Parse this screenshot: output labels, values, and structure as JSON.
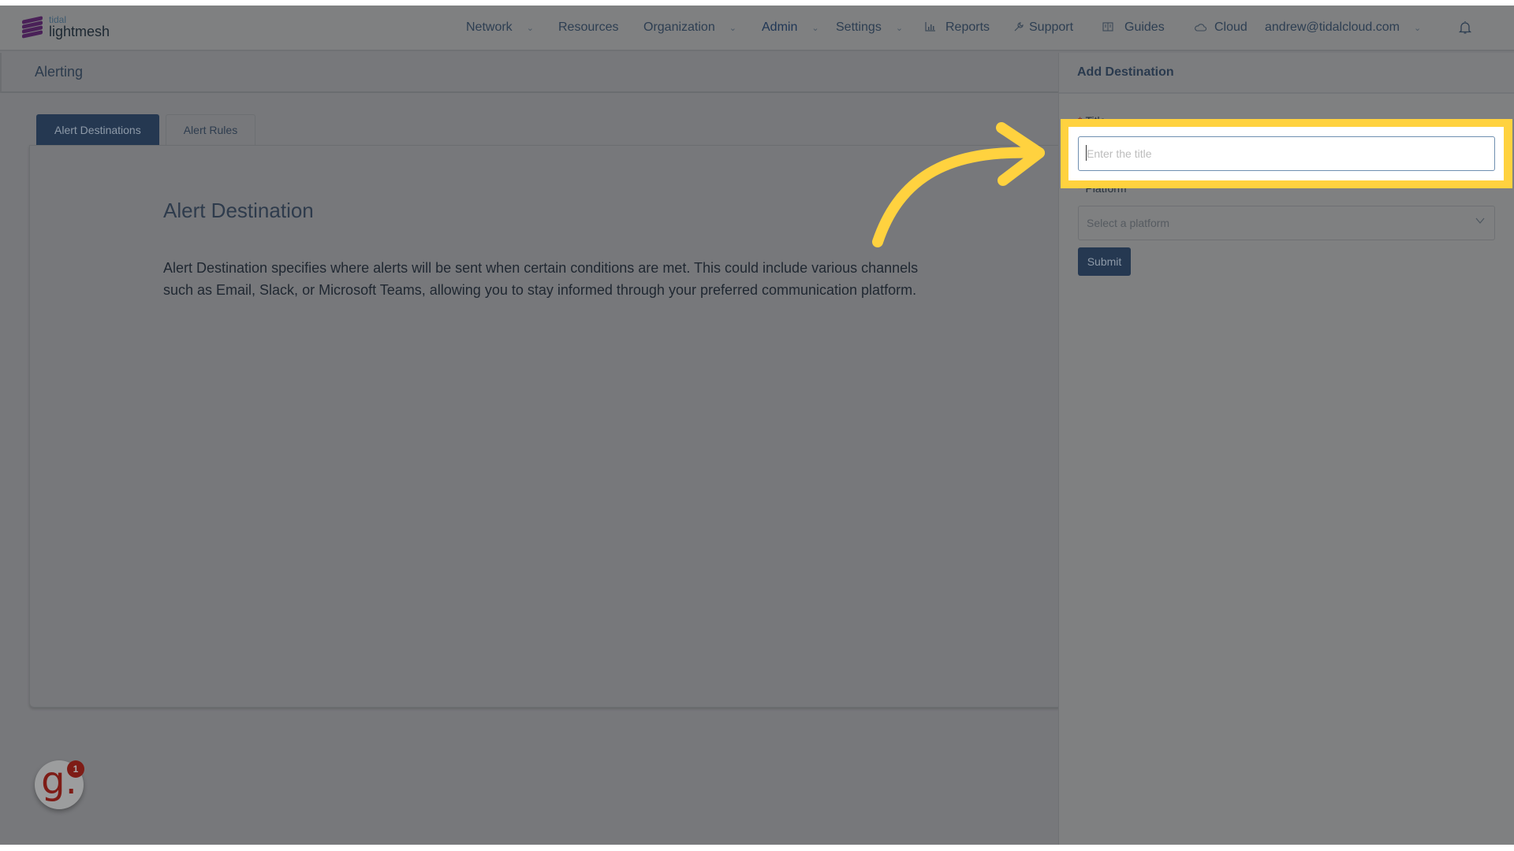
{
  "brand": {
    "small": "tidal",
    "big": "lightmesh"
  },
  "nav": {
    "items": [
      {
        "label": "Network",
        "has_dropdown": true,
        "icon": null
      },
      {
        "label": "Resources",
        "has_dropdown": false,
        "icon": null
      },
      {
        "label": "Organization",
        "has_dropdown": true,
        "icon": null
      },
      {
        "label": "Admin",
        "has_dropdown": true,
        "icon": null,
        "active": true
      },
      {
        "label": "Settings",
        "has_dropdown": true,
        "icon": null
      },
      {
        "label": "Reports",
        "has_dropdown": false,
        "icon": "bar-chart-icon"
      },
      {
        "label": "Support",
        "has_dropdown": false,
        "icon": "wrench-icon"
      },
      {
        "label": "Guides",
        "has_dropdown": false,
        "icon": "book-icon"
      },
      {
        "label": "Cloud",
        "has_dropdown": false,
        "icon": "cloud-icon"
      }
    ],
    "user": "andrew@tidalcloud.com",
    "chevron": "⌄",
    "notifications_icon": "bell-icon"
  },
  "page": {
    "title": "Alerting",
    "tabs": [
      {
        "label": "Alert Destinations",
        "active": true
      },
      {
        "label": "Alert Rules",
        "active": false
      }
    ],
    "card": {
      "title": "Alert Destination",
      "description": "Alert Destination specifies where alerts will be sent when certain conditions are met. This could include various channels such as Email, Slack, or Microsoft Teams, allowing you to stay informed through your preferred communication platform."
    }
  },
  "drawer": {
    "title": "Add Destination",
    "fields": {
      "title": {
        "label": "Title",
        "required": true,
        "value": "",
        "placeholder": "Enter the title"
      },
      "platform": {
        "label": "Platform",
        "required": true,
        "value": "",
        "placeholder": "Select a platform"
      }
    },
    "submit_label": "Submit",
    "required_marker": "*"
  },
  "widget": {
    "glyph": "g.",
    "count": "1"
  },
  "annotation": {
    "highlight_color": "#ffd23f",
    "target": "title-input"
  },
  "colors": {
    "primary": "#253851",
    "highlight": "#ffd23f",
    "badge": "#7e1c16"
  }
}
